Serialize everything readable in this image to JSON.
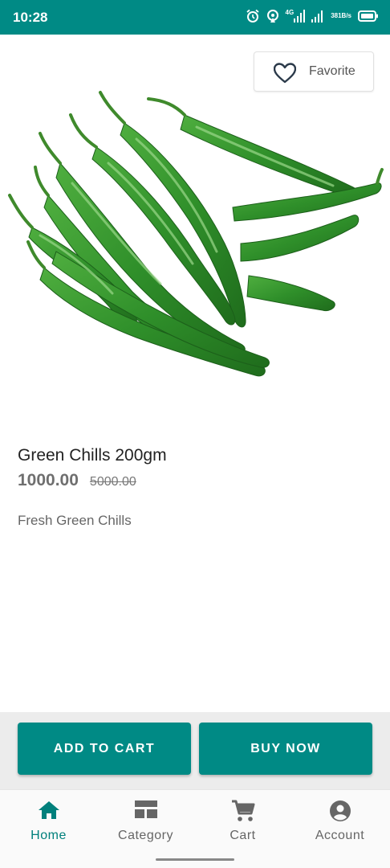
{
  "status_bar": {
    "time": "10:28",
    "network": "4G",
    "speed_value": "381",
    "speed_unit": "B/s",
    "icons": [
      "alarm-icon",
      "hotspot-icon",
      "signal-icon",
      "signal-icon",
      "battery-icon"
    ]
  },
  "product": {
    "image": "green-chillies-image",
    "favorite_label": "Favorite",
    "title": "Green Chills 200gm",
    "price": "1000.00",
    "old_price": "5000.00",
    "description": "Fresh Green Chills"
  },
  "actions": {
    "add_to_cart": "ADD TO CART",
    "buy_now": "BUY NOW"
  },
  "nav": {
    "items": [
      {
        "label": "Home",
        "icon": "home-icon",
        "active": true
      },
      {
        "label": "Category",
        "icon": "category-icon",
        "active": false
      },
      {
        "label": "Cart",
        "icon": "cart-icon",
        "active": false
      },
      {
        "label": "Account",
        "icon": "account-icon",
        "active": false
      }
    ]
  },
  "colors": {
    "primary": "#008a85",
    "active_nav": "#00807c",
    "chilli_green": "#2f8f2a"
  }
}
